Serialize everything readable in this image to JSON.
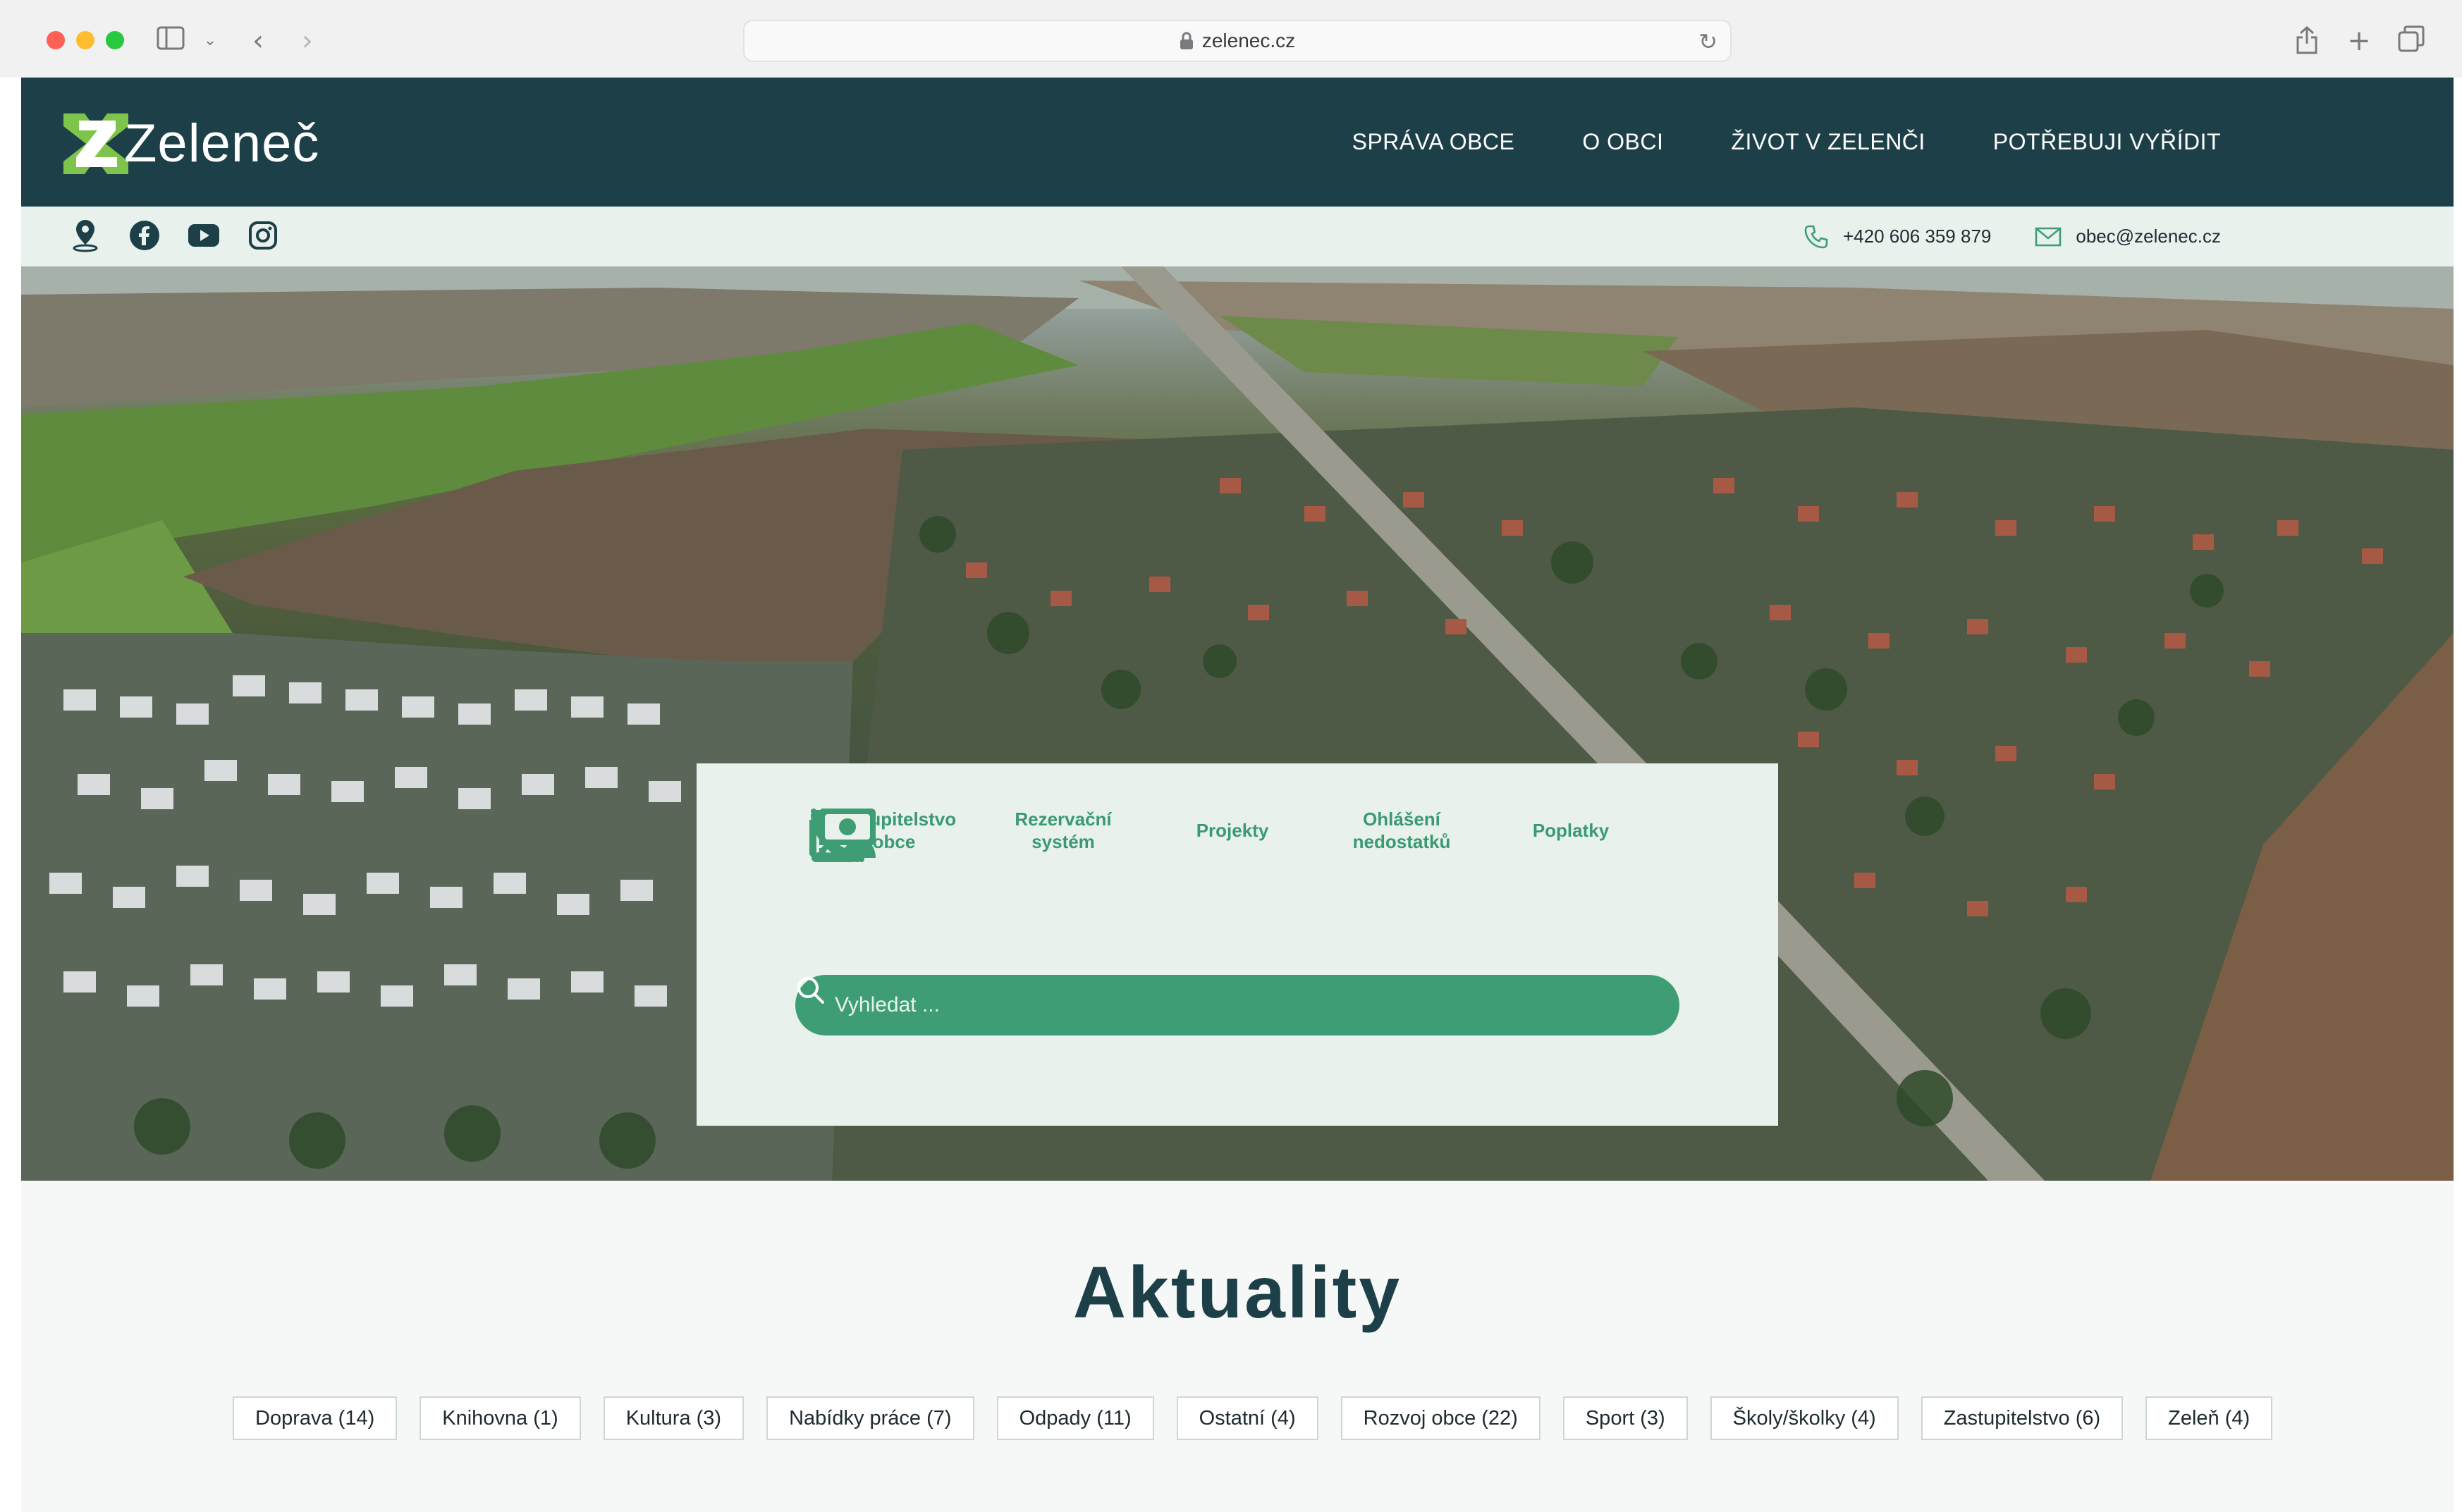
{
  "browser": {
    "url": "zelenec.cz"
  },
  "site": {
    "logo_text": "Zeleneč",
    "nav": [
      "SPRÁVA OBCE",
      "O OBCI",
      "ŽIVOT V ZELENČI",
      "POTŘEBUJI VYŘÍDIT"
    ],
    "phone": "+420 606 359 879",
    "email": "obec@zelenec.cz",
    "socials": [
      "map-pin-icon",
      "facebook-icon",
      "youtube-icon",
      "instagram-icon"
    ]
  },
  "quick_links": [
    {
      "label": "Zastupitelstvo\nobce",
      "icon": "users-icon"
    },
    {
      "label": "Rezervační\nsystém",
      "icon": "calendar-icon"
    },
    {
      "label": "Projekty",
      "icon": "route-icon"
    },
    {
      "label": "Ohlášení\nnedostatků",
      "icon": "phone-volume-icon"
    },
    {
      "label": "Poplatky",
      "icon": "money-icon"
    }
  ],
  "search": {
    "placeholder": "Vyhledat ..."
  },
  "news": {
    "title_first": "A",
    "title_rest": "ktuality",
    "tags": [
      "Doprava (14)",
      "Knihovna (1)",
      "Kultura (3)",
      "Nabídky práce (7)",
      "Odpady (11)",
      "Ostatní (4)",
      "Rozvoj obce (22)",
      "Sport (3)",
      "Školy/školky (4)",
      "Zastupitelstvo (6)",
      "Zeleň (4)"
    ]
  },
  "colors": {
    "header_bg": "#1d4048",
    "accent_green": "#3e9d74",
    "panel_bg": "#e9f1ec",
    "logo_green": "#7fc44a"
  }
}
